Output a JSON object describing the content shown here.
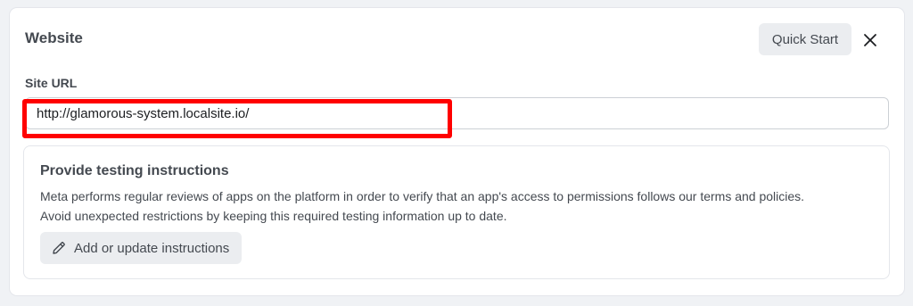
{
  "header": {
    "title": "Website",
    "quick_start_label": "Quick Start",
    "close_icon": "close-icon"
  },
  "site_url": {
    "label": "Site URL",
    "value": "http://glamorous-system.localsite.io/"
  },
  "testing": {
    "title": "Provide testing instructions",
    "description_line1": "Meta performs regular reviews of apps on the platform in order to verify that an app's access to permissions follows our terms and policies.",
    "description_line2": "Avoid unexpected restrictions by keeping this required testing information up to date.",
    "button_label": "Add or update instructions",
    "button_icon": "pencil-icon"
  },
  "colors": {
    "highlight": "#ff0000",
    "panel_bg": "#ffffff",
    "page_bg": "#f0f2f5",
    "button_bg": "#ebedf0"
  }
}
